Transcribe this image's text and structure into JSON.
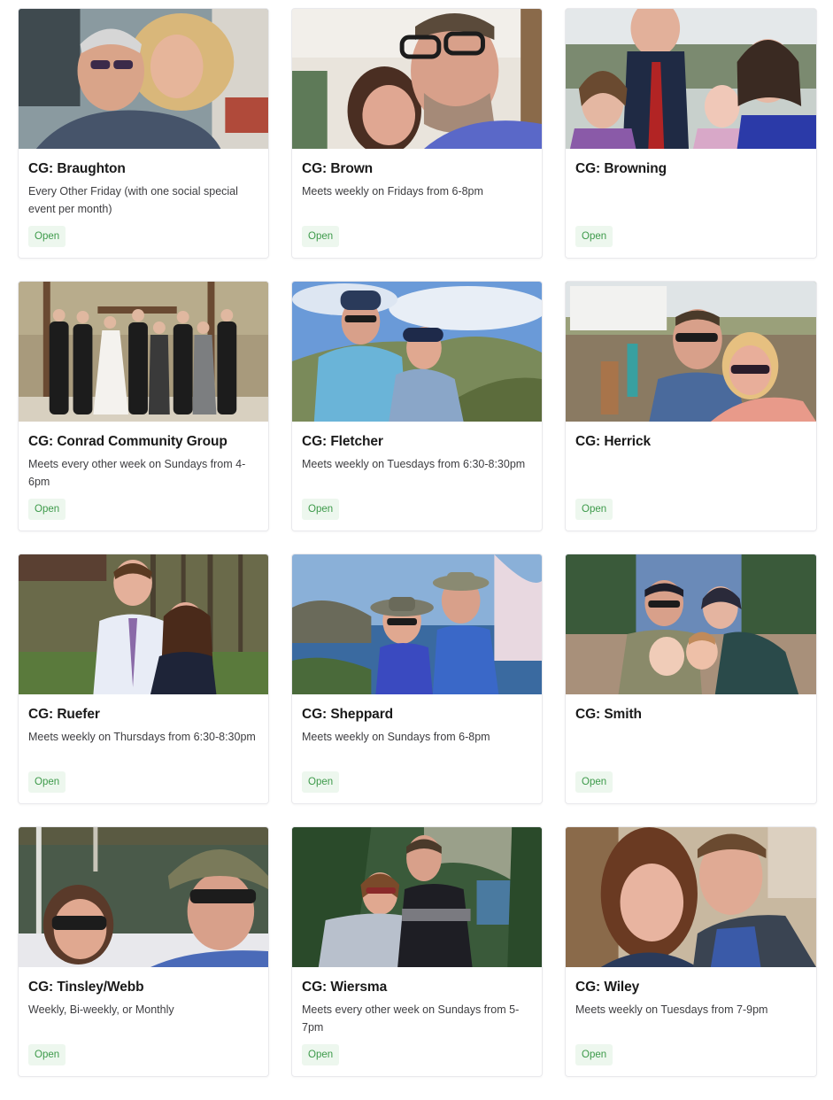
{
  "groups": [
    {
      "title": "CG: Braughton",
      "description": "Every Other Friday (with one social special event per month)",
      "status": "Open",
      "photo": "group-selfie-couple"
    },
    {
      "title": "CG: Brown",
      "description": "Meets weekly on Fridays from 6-8pm",
      "status": "Open",
      "photo": "couple-selfie-glasses"
    },
    {
      "title": "CG: Browning",
      "description": "",
      "status": "Open",
      "photo": "family-with-kids"
    },
    {
      "title": "CG: Conrad Community Group",
      "description": "Meets every other week on Sundays from 4-6pm",
      "status": "Open",
      "photo": "wedding-party"
    },
    {
      "title": "CG: Fletcher",
      "description": "Meets weekly on Tuesdays from 6:30-8:30pm",
      "status": "Open",
      "photo": "hikers-mountain-view"
    },
    {
      "title": "CG: Herrick",
      "description": "",
      "status": "Open",
      "photo": "couple-outdoor-deck"
    },
    {
      "title": "CG: Ruefer",
      "description": "Meets weekly on Thursdays from 6:30-8:30pm",
      "status": "Open",
      "photo": "couple-by-pavilion"
    },
    {
      "title": "CG: Sheppard",
      "description": "Meets weekly on Sundays from 6-8pm",
      "status": "Open",
      "photo": "hikers-coastline"
    },
    {
      "title": "CG: Smith",
      "description": "",
      "status": "Open",
      "photo": "family-in-woods"
    },
    {
      "title": "CG: Tinsley/Webb",
      "description": "Weekly, Bi-weekly, or Monthly",
      "status": "Open",
      "photo": "couple-on-boat"
    },
    {
      "title": "CG: Wiersma",
      "description": "Meets every other week on Sundays from 5-7pm",
      "status": "Open",
      "photo": "couple-at-lake"
    },
    {
      "title": "CG: Wiley",
      "description": "Meets weekly on Tuesdays from 7-9pm",
      "status": "Open",
      "photo": "couple-selfie-outdoors"
    }
  ],
  "colors": {
    "badge_bg": "#edf7ee",
    "badge_text": "#3d9a4a",
    "card_border": "#e9e9ec"
  }
}
